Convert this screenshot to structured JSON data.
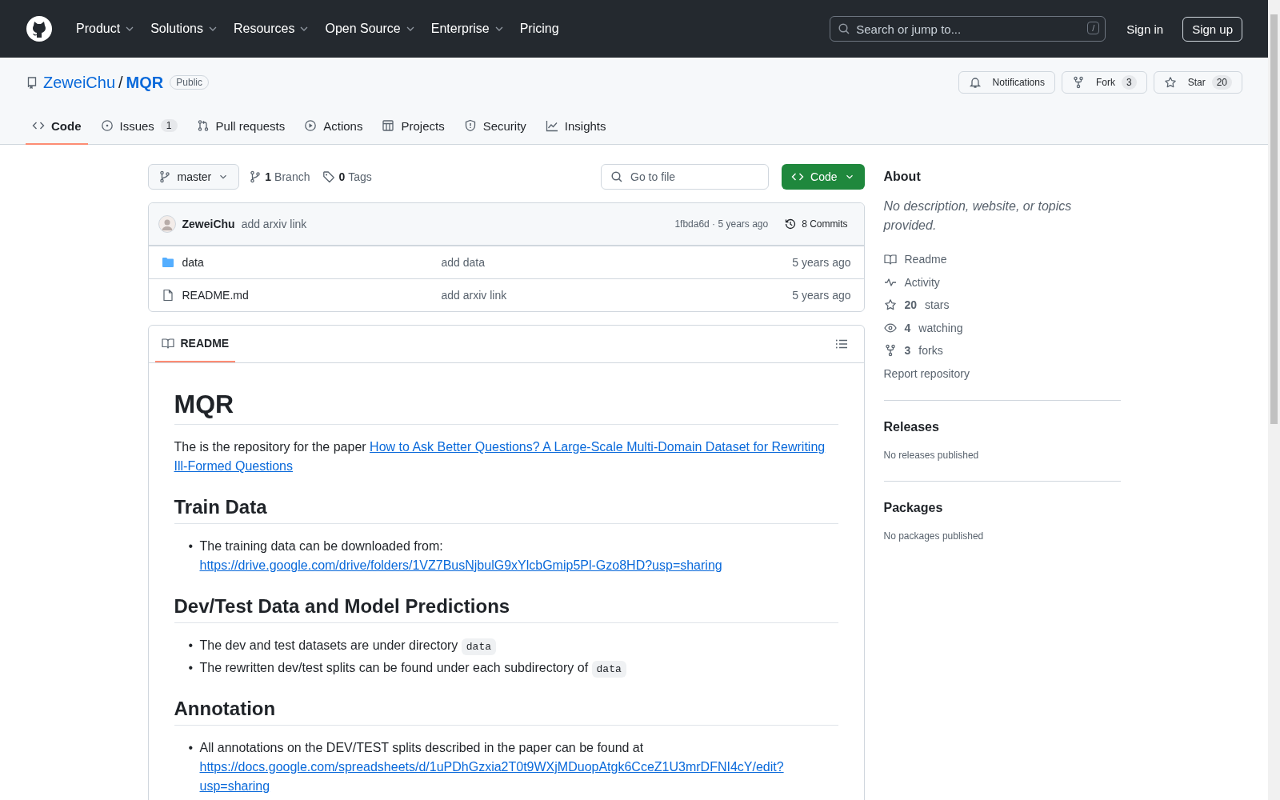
{
  "header": {
    "nav": [
      {
        "label": "Product",
        "caret": true
      },
      {
        "label": "Solutions",
        "caret": true
      },
      {
        "label": "Resources",
        "caret": true
      },
      {
        "label": "Open Source",
        "caret": true
      },
      {
        "label": "Enterprise",
        "caret": true
      },
      {
        "label": "Pricing",
        "caret": false
      }
    ],
    "search": {
      "placeholder": "Search or jump to...",
      "shortcut": "/"
    },
    "sign_in": "Sign in",
    "sign_up": "Sign up"
  },
  "repo": {
    "owner": "ZeweiChu",
    "separator": "/",
    "name": "MQR",
    "visibility": "Public",
    "actions": [
      {
        "kind": "notifications",
        "label": "Notifications"
      },
      {
        "kind": "fork",
        "label": "Fork",
        "count": "3"
      },
      {
        "kind": "star",
        "label": "Star",
        "count": "20"
      }
    ],
    "tabs": [
      {
        "kind": "code",
        "label": "Code",
        "selected": true
      },
      {
        "kind": "issues",
        "label": "Issues",
        "count": "1",
        "selected": false
      },
      {
        "kind": "pulls",
        "label": "Pull requests",
        "selected": false
      },
      {
        "kind": "actions",
        "label": "Actions",
        "selected": false
      },
      {
        "kind": "projects",
        "label": "Projects",
        "selected": false
      },
      {
        "kind": "security",
        "label": "Security",
        "selected": false
      },
      {
        "kind": "insights",
        "label": "Insights",
        "selected": false
      }
    ]
  },
  "toolbar": {
    "branch": "master",
    "branches": {
      "count": "1",
      "label": "Branch"
    },
    "tags": {
      "count": "0",
      "label": "Tags"
    },
    "go_to_file": {
      "placeholder": "Go to file"
    },
    "code_button": "Code"
  },
  "commit": {
    "author": "ZeweiChu",
    "message": "add arxiv link",
    "meta": "1fbda6d · 5 years ago",
    "commits": "8 Commits"
  },
  "files": [
    {
      "kind": "folder",
      "name": "data",
      "message": "add data",
      "age": "5 years ago"
    },
    {
      "kind": "file",
      "name": "README.md",
      "message": "add arxiv link",
      "age": "5 years ago"
    }
  ],
  "readme": {
    "tab": "README",
    "blocks": [
      {
        "kind": "h1",
        "text": "MQR"
      },
      {
        "kind": "p",
        "text": "The is the repository for the paper",
        "link_lines": [
          "How to Ask Better Questions? A Large-Scale Multi-Domain Dataset for Rewriting",
          "Ill-Formed Questions"
        ]
      },
      {
        "kind": "h2",
        "text": "Train Data"
      },
      {
        "kind": "list",
        "items": [
          {
            "bullet": "•",
            "text": "The training data can be downloaded from:",
            "link": "https://drive.google.com/drive/folders/1VZ7BusNjbulG9xYlcbGmip5Pl-Gzo8HD?usp=sharing"
          }
        ]
      },
      {
        "kind": "h2",
        "text": "Dev/Test Data and Model Predictions"
      },
      {
        "kind": "list",
        "items": [
          {
            "bullet": "•",
            "text": "The dev and test datasets are under directory",
            "code": "data"
          },
          {
            "bullet": "•",
            "text": "The rewritten dev/test splits can be found under each subdirectory of",
            "code": "data"
          }
        ]
      },
      {
        "kind": "h2",
        "text": "Annotation"
      },
      {
        "kind": "list",
        "items": [
          {
            "bullet": "•",
            "text": "All annotations on the DEV/TEST splits described in the paper can be found at",
            "link": "https://docs.google.com/spreadsheets/d/1uPDhGzxia2T0t9WXjMDuopAtgk6CceZ1U3mrDFNI4cY/edit?usp=sharing"
          }
        ]
      }
    ]
  },
  "about": {
    "title": "About",
    "description": "No description, website, or topics provided.",
    "links": [
      {
        "kind": "readme",
        "label": "Readme"
      },
      {
        "kind": "activity",
        "label": "Activity"
      },
      {
        "kind": "stars",
        "count": "20",
        "label": "stars"
      },
      {
        "kind": "watching",
        "count": "4",
        "label": "watching"
      },
      {
        "kind": "forks",
        "count": "3",
        "label": "forks"
      }
    ],
    "report": "Report repository"
  },
  "releases": {
    "title": "Releases",
    "note": "No releases published"
  },
  "packages": {
    "title": "Packages",
    "note": "No packages published"
  }
}
